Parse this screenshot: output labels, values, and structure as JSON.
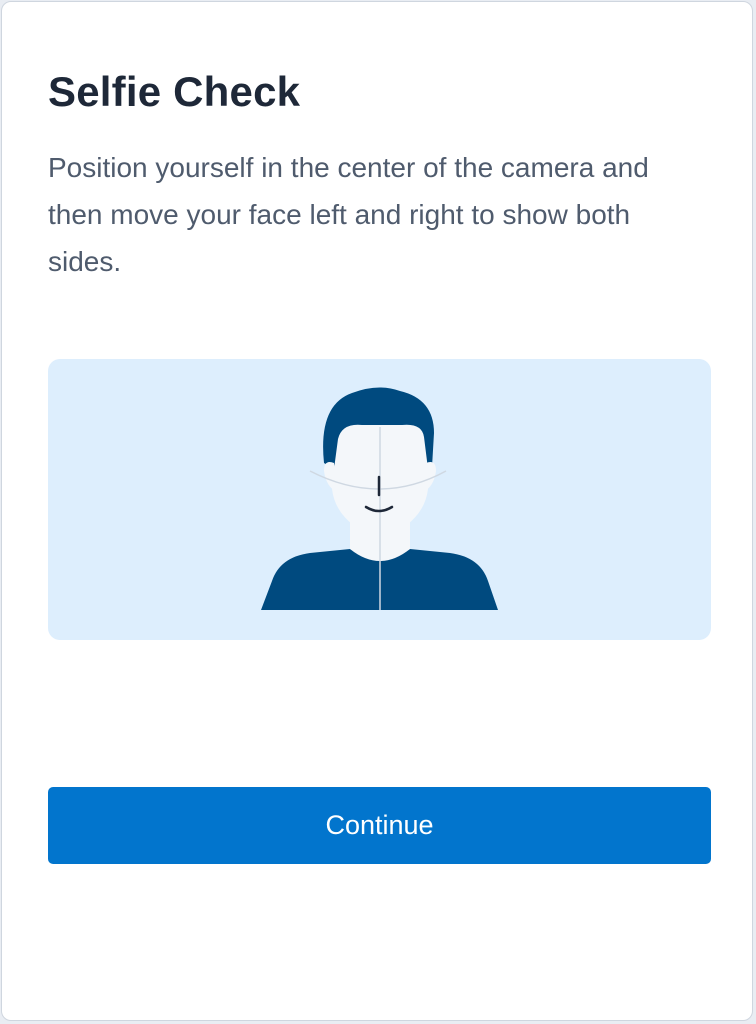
{
  "page": {
    "title": "Selfie Check",
    "description": "Position yourself in the center of the camera and then move your face left and right to show both sides.",
    "continue_label": "Continue"
  },
  "colors": {
    "primary": "#0275cd",
    "illustration_bg": "#ddeefd",
    "hair_shirt": "#004a7f",
    "skin": "#f4f7fa",
    "title_text": "#1e2838",
    "body_text": "#4f5b6d"
  },
  "illustration": {
    "subject": "person-face-outline-icon"
  }
}
